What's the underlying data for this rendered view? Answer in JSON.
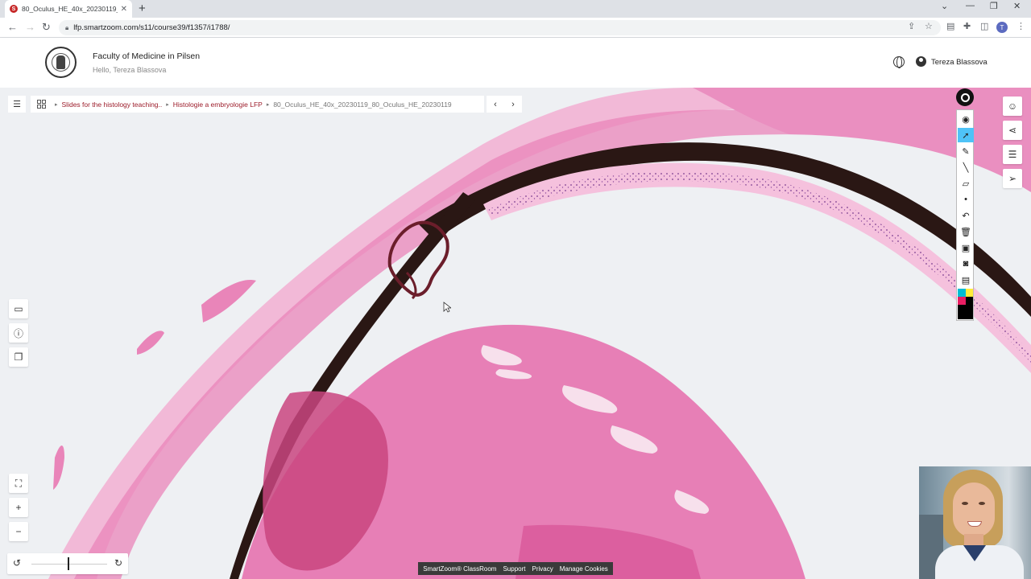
{
  "browser": {
    "tab_title": "80_Oculus_HE_40x_20230119_80",
    "tab_close": "✕",
    "new_tab": "+",
    "url": "lfp.smartzoom.com/s11/course39/f1357/i1788/",
    "window_controls": [
      "⌄",
      "—",
      "❐",
      "✕"
    ],
    "profile_initial": "T"
  },
  "header": {
    "faculty": "Faculty of Medicine in Pilsen",
    "greeting": "Hello, Tereza Blassova",
    "username": "Tereza Blassova"
  },
  "breadcrumb": {
    "items": [
      "Slides for the histology teaching..",
      "Histologie a embryologie LFP"
    ],
    "current": "80_Oculus_HE_40x_20230119_80_Oculus_HE_20230119"
  },
  "footer": {
    "brand": "SmartZoom® ClassRoom",
    "links": [
      "Support",
      "Privacy",
      "Manage Cookies"
    ]
  },
  "colors": {
    "accent": "#9c1c2a",
    "tissue_pink": "#e985b9",
    "tissue_light": "#f2b9d7",
    "pigment": "#2a1714",
    "active_tool": "#4fc3f7"
  },
  "icons": {
    "menu": "list-menu-icon",
    "grid": "grid-icon",
    "comment": "comment-icon",
    "info": "info-icon",
    "gallery": "gallery-icon",
    "fullscreen": "fullscreen-icon",
    "zoom_in": "plus-icon",
    "zoom_out": "minus-icon",
    "share": "share-icon",
    "settings": "sliders-icon",
    "pointer": "navigation-arrow-icon"
  }
}
